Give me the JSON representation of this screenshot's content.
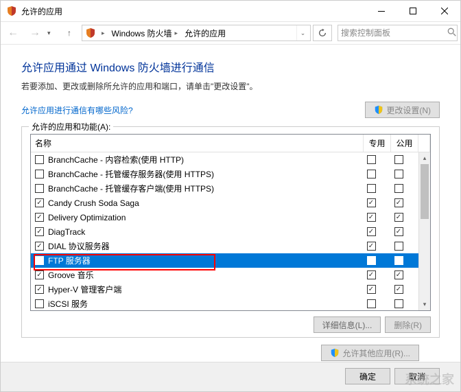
{
  "window": {
    "title": "允许的应用"
  },
  "nav": {
    "crumb1": "Windows 防火墙",
    "crumb2": "允许的应用",
    "search_placeholder": "搜索控制面板"
  },
  "page": {
    "heading": "允许应用通过 Windows 防火墙进行通信",
    "desc": "若要添加、更改或删除所允许的应用和端口，请单击\"更改设置\"。",
    "risk_link": "允许应用进行通信有哪些风险?",
    "change_settings_btn": "更改设置(N)"
  },
  "list": {
    "legend": "允许的应用和功能(A):",
    "col_name": "名称",
    "col_private": "专用",
    "col_public": "公用",
    "items": [
      {
        "name": "BranchCache - 内容检索(使用 HTTP)",
        "en": false,
        "priv": false,
        "pub": false
      },
      {
        "name": "BranchCache - 托管缓存服务器(使用 HTTPS)",
        "en": false,
        "priv": false,
        "pub": false
      },
      {
        "name": "BranchCache - 托管缓存客户端(使用 HTTPS)",
        "en": false,
        "priv": false,
        "pub": false
      },
      {
        "name": "Candy Crush Soda Saga",
        "en": true,
        "priv": true,
        "pub": true
      },
      {
        "name": "Delivery Optimization",
        "en": true,
        "priv": true,
        "pub": true
      },
      {
        "name": "DiagTrack",
        "en": true,
        "priv": true,
        "pub": true
      },
      {
        "name": "DIAL 协议服务器",
        "en": true,
        "priv": true,
        "pub": false
      },
      {
        "name": "FTP 服务器",
        "en": true,
        "priv": false,
        "pub": true,
        "selected": true
      },
      {
        "name": "Groove 音乐",
        "en": true,
        "priv": true,
        "pub": true
      },
      {
        "name": "Hyper-V 管理客户端",
        "en": true,
        "priv": true,
        "pub": true
      },
      {
        "name": "iSCSI 服务",
        "en": false,
        "priv": false,
        "pub": false
      }
    ],
    "details_btn": "详细信息(L)...",
    "remove_btn": "删除(R)",
    "allow_other_btn": "允许其他应用(R)..."
  },
  "actions": {
    "ok": "确定",
    "cancel": "取消"
  },
  "watermark": "系统之家"
}
